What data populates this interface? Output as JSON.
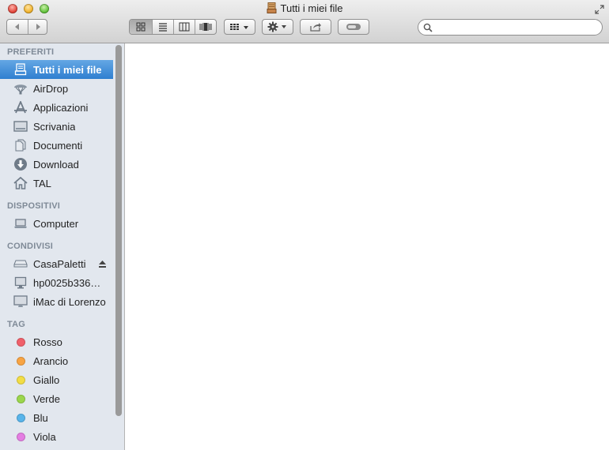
{
  "window": {
    "title": "Tutti i miei file"
  },
  "toolbar": {
    "nav": [
      "back-arrow-icon",
      "forward-arrow-icon"
    ],
    "view_modes": [
      "icon-view",
      "list-view",
      "column-view",
      "cover-flow-view"
    ],
    "arrange_icon": "arrange-grid-icon",
    "action_icon": "gear-icon",
    "share_icon": "share-icon",
    "tags_icon": "tag-toggle-icon"
  },
  "search": {
    "placeholder": ""
  },
  "sidebar": {
    "favorites": {
      "title": "PREFERITI",
      "items": [
        {
          "label": "Tutti i miei file",
          "icon": "all-my-files-icon",
          "selected": true
        },
        {
          "label": "AirDrop",
          "icon": "airdrop-icon"
        },
        {
          "label": "Applicazioni",
          "icon": "applications-icon"
        },
        {
          "label": "Scrivania",
          "icon": "desktop-icon"
        },
        {
          "label": "Documenti",
          "icon": "documents-icon"
        },
        {
          "label": "Download",
          "icon": "download-icon"
        },
        {
          "label": "TAL",
          "icon": "home-icon"
        }
      ]
    },
    "devices": {
      "title": "DISPOSITIVI",
      "items": [
        {
          "label": "Computer",
          "icon": "laptop-icon"
        }
      ]
    },
    "shared": {
      "title": "CONDIVISI",
      "items": [
        {
          "label": "CasaPaletti",
          "icon": "server-icon",
          "eject": true
        },
        {
          "label": "hp0025b336…",
          "icon": "monitor-icon"
        },
        {
          "label": "iMac di Lorenzo",
          "icon": "imac-icon"
        }
      ]
    },
    "tags": {
      "title": "TAG",
      "items": [
        {
          "label": "Rosso",
          "color": "#f0606a"
        },
        {
          "label": "Arancio",
          "color": "#f8a443"
        },
        {
          "label": "Giallo",
          "color": "#f2dd45"
        },
        {
          "label": "Verde",
          "color": "#9bd64c"
        },
        {
          "label": "Blu",
          "color": "#58b4ea"
        },
        {
          "label": "Viola",
          "color": "#e47ee2"
        }
      ]
    }
  }
}
